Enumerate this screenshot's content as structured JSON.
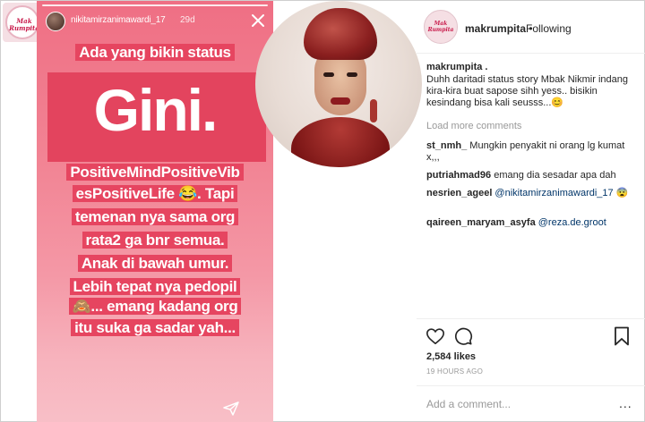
{
  "left_logo": {
    "line1": "Mak",
    "line2": "Rumpita"
  },
  "story": {
    "username": "nikitamirzanimawardi_17",
    "time": "29d",
    "lines": [
      "Ada yang bikin status",
      "Gini.",
      "PositiveMindPositiveVib",
      "esPositiveLife 😂. Tapi",
      "temenan nya sama org",
      "rata2 ga bnr semua.",
      "Anak di bawah umur.",
      "Lebih tepat nya pedopil",
      "🙈... emang kadang org",
      "itu suka ga sadar yah..."
    ],
    "colors": {
      "background_top": "#ef6f84",
      "highlight": "#e64560"
    }
  },
  "post": {
    "account": "makrumpita",
    "dot": " •",
    "follow_status": "Following",
    "caption_user": "makrumpita .",
    "caption": "Duhh daritadi status story Mbak Nikmir indang kira-kira buat sapose sihh yess.. bisikin kesindang bisa kali seusss...😊",
    "load_more": "Load more comments",
    "comments": [
      {
        "user": "st_nmh_",
        "text": " Mungkin penyakit ni orang lg kumat x,,,"
      },
      {
        "user": "putriahmad96",
        "text": " emang dia sesadar apa dah"
      },
      {
        "user": "nesrien_ageel",
        "mention": " @nikitamirzanimawardi_17",
        "text": " 😨"
      },
      {
        "user": "qaireen_maryam_asyfa",
        "mention": " @reza.de.groot",
        "text": ""
      }
    ],
    "likes": "2,584 likes",
    "posted": "19 HOURS AGO",
    "add_comment_placeholder": "Add a comment...",
    "more_icon": "..."
  },
  "icons": [
    "close-icon",
    "send-icon",
    "heart-icon",
    "comment-icon",
    "bookmark-icon"
  ]
}
